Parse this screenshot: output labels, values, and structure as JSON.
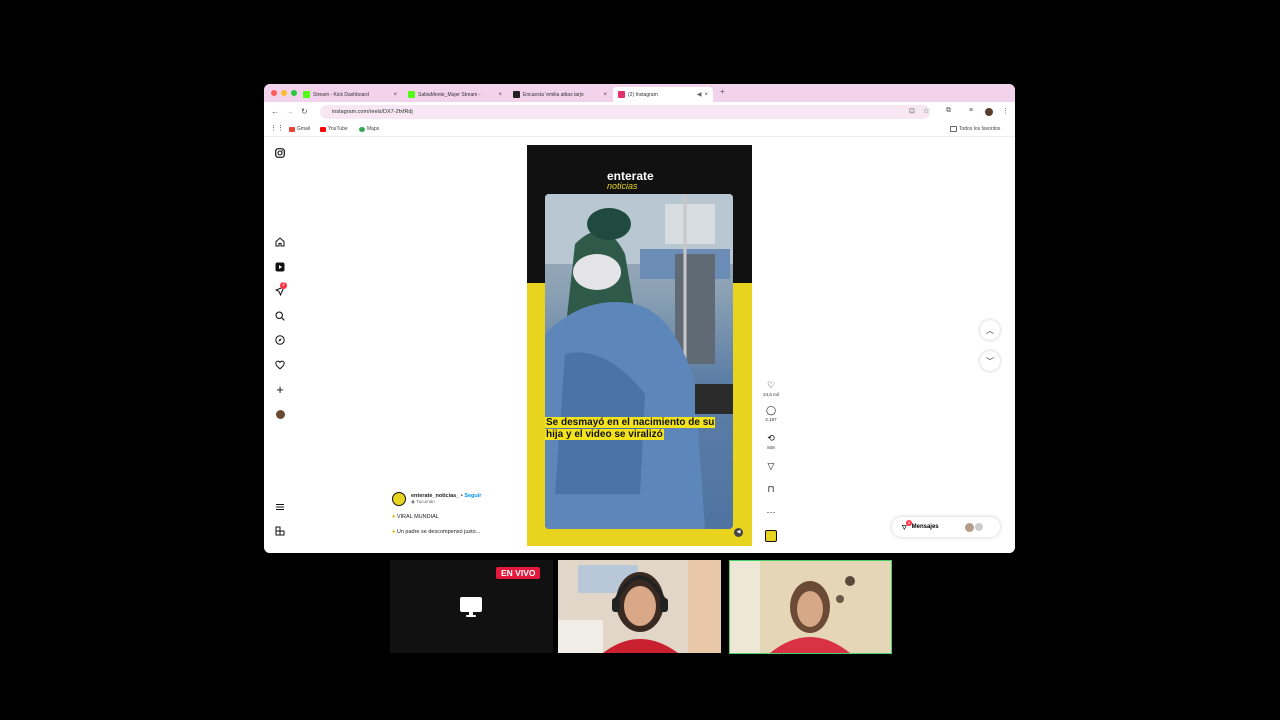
{
  "browser": {
    "tabs": [
      {
        "title": "Stream - Kick Dashboard",
        "favicon_color": "#53fc18"
      },
      {
        "title": "SabiaMente_Mujer Stream -",
        "favicon_color": "#53fc18"
      },
      {
        "title": "Encuesta 'emilia attias tarjo",
        "favicon_color": "#222222"
      },
      {
        "title": "(2) Instagram",
        "favicon_color": "#e1306c",
        "active": true
      }
    ],
    "new_tab": "+",
    "url": "instagram.com/reels/DX7-2fxfRdj",
    "bookmarks": [
      "Gmail",
      "YouTube",
      "Maps"
    ],
    "all_bookmarks": "Todos los favoritos"
  },
  "instagram": {
    "sidebar": {
      "notification_count": "2"
    },
    "reel": {
      "brand_top": "enterate",
      "brand_bottom": "noticias",
      "caption": "Se desmayó en el nacimiento de su hija y el video se viralizó"
    },
    "actions": {
      "likes": "24,6 mil",
      "comments": "2.197",
      "reposts": "848"
    },
    "post": {
      "username": "enterate_noticias_",
      "separator": "•",
      "follow_label": "Seguir",
      "location": "Tucumán",
      "line1": "VIRAL MUNDIAL",
      "line2": "Un padre se descompensó justo..."
    },
    "messages": {
      "label": "Mensajes",
      "badge": "2"
    }
  },
  "stream": {
    "live_badge": "EN VIVO"
  },
  "colors": {
    "brand_yellow": "#e8d41f",
    "live_red": "#e3183c",
    "accent_blue": "#0095f6",
    "speaker_border": "#4ad06a"
  }
}
